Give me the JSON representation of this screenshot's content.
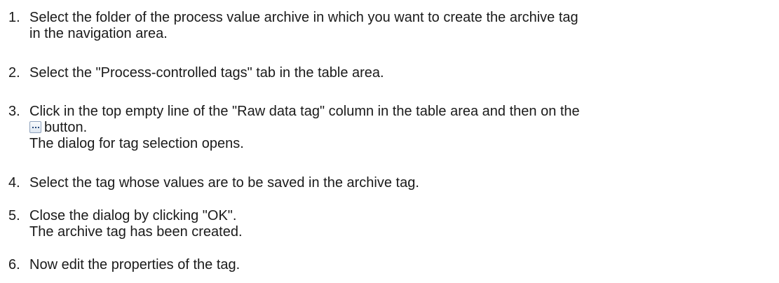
{
  "steps": [
    {
      "number": "1.",
      "lines": [
        "Select the folder of the process value archive in which you want to create the archive tag",
        "in the navigation area."
      ]
    },
    {
      "number": "2.",
      "lines": [
        "Select the \"Process-controlled tags\" tab in the table area."
      ]
    },
    {
      "number": "3.",
      "lines": [
        "Click in the top empty line of the \"Raw data tag\" column in the table area and then on the"
      ],
      "after_icon": "button.",
      "result": "The dialog for tag selection opens.",
      "icon": "ellipsis-button-icon"
    },
    {
      "number": "4.",
      "lines": [
        "Select the tag whose values are to be saved in the archive tag."
      ]
    },
    {
      "number": "5.",
      "lines": [
        "Close the dialog by clicking \"OK\"."
      ],
      "result": "The archive tag has been created."
    },
    {
      "number": "6.",
      "lines": [
        "Now edit the properties of the tag."
      ]
    }
  ]
}
